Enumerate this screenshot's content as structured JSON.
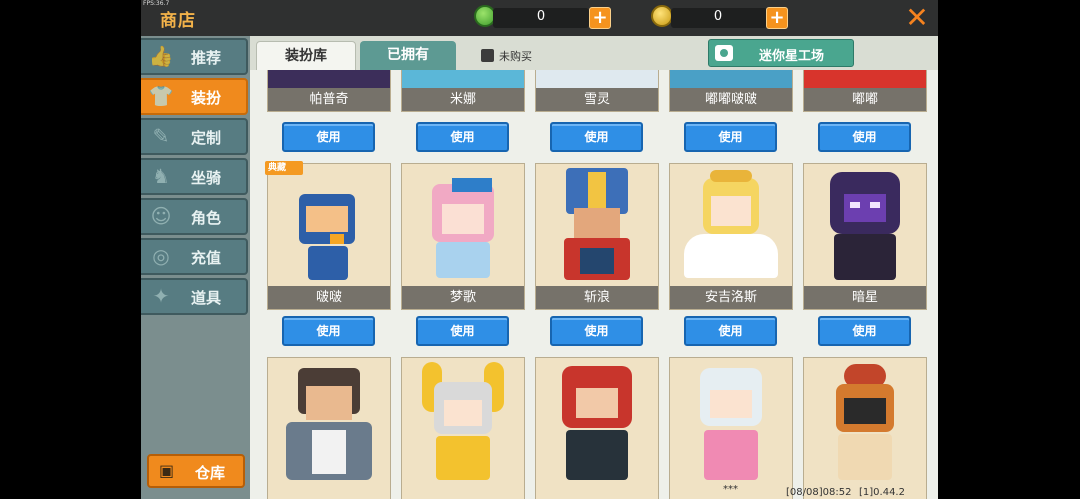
{
  "topbar": {
    "fps": "FPS:36.7",
    "title": "商店",
    "mini_coin": "0",
    "star_coin": "0",
    "plus": "+",
    "close": "✕"
  },
  "sidebar": {
    "items": [
      {
        "label": "推荐",
        "icon": "thumb-icon"
      },
      {
        "label": "装扮",
        "icon": "shirt-icon"
      },
      {
        "label": "定制",
        "icon": "pencil-icon"
      },
      {
        "label": "坐骑",
        "icon": "mount-icon"
      },
      {
        "label": "角色",
        "icon": "person-icon"
      },
      {
        "label": "充值",
        "icon": "coins-icon"
      },
      {
        "label": "道具",
        "icon": "tools-icon"
      }
    ],
    "active_index": 1,
    "warehouse": "仓库"
  },
  "tabs": {
    "wardrobe": "装扮库",
    "owned": "已拥有",
    "unbought": "未购买",
    "mini_workshop": "迷你星工场"
  },
  "grid": {
    "use_label": "使用",
    "badge": "典藏",
    "row1": [
      "帕普奇",
      "米娜",
      "雪灵",
      "嘟嘟啵啵",
      "嘟嘟"
    ],
    "row2": [
      "啵啵",
      "梦歌",
      "斩浪",
      "安吉洛斯",
      "暗星"
    ],
    "row3": [
      "",
      "",
      "",
      "",
      ""
    ]
  },
  "footer": {
    "dots": "***",
    "datetime": "[08/08]08:52",
    "version": "[1]0.44.2"
  },
  "colors": {
    "accent_orange": "#f08a1d",
    "use_blue": "#2f8fe6",
    "sidebar_teal": "#577c82",
    "workshop_green": "#4aa68f"
  }
}
